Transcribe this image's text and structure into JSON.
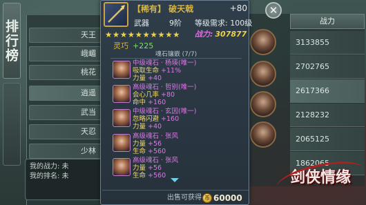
{
  "ranking": {
    "title": "排行榜",
    "rows": [
      "天王",
      "峨嵋",
      "桃花",
      "逍遥",
      "武当",
      "天忍",
      "少林"
    ],
    "self_lines": [
      "我的战力: 未",
      "我的排名: 未"
    ]
  },
  "power_list": {
    "header": "战力",
    "values": [
      "3133855",
      "2702765",
      "2617366",
      "2128232",
      "2065125",
      "1862065"
    ]
  },
  "logo": {
    "text": "剑侠情缘"
  },
  "popup": {
    "item": {
      "name": "【稀有】 破天戟",
      "enhance": "+80",
      "type": "武器",
      "grade": "9阶",
      "requirement": "等级需求: 100级",
      "stars": "★★★★★★★★★★",
      "power_label": "战力:",
      "power_value": "307877",
      "bonus_key": "灵巧",
      "bonus_value": "+225"
    },
    "section_title": "魂石镶嵌 (7/7)",
    "gems": [
      {
        "name": "中级魂石 · 杨瑛(唯一)",
        "l1k": "吸取生命",
        "l1v": "+11%",
        "l2k": "力量",
        "l2v": "+40"
      },
      {
        "name": "高级魂石 · 哲别(唯一)",
        "l1k": "会心几率",
        "l1v": "+80",
        "l2k": "命中",
        "l2v": "+160"
      },
      {
        "name": "中级魂石 · 玄因(唯一)",
        "l1k": "忽略闪避",
        "l1v": "+160",
        "l2k": "力量",
        "l2v": "+40"
      },
      {
        "name": "高级魂石 · 张风",
        "l1k": "力量",
        "l1v": "+56",
        "l2k": "生命",
        "l2v": "+560"
      },
      {
        "name": "高级魂石 · 张风",
        "l1k": "力量",
        "l1v": "+56",
        "l2k": "生命",
        "l2v": "+560"
      }
    ],
    "sell_label": "出售可获得",
    "sell_value": "60000",
    "close_label": "✕"
  }
}
